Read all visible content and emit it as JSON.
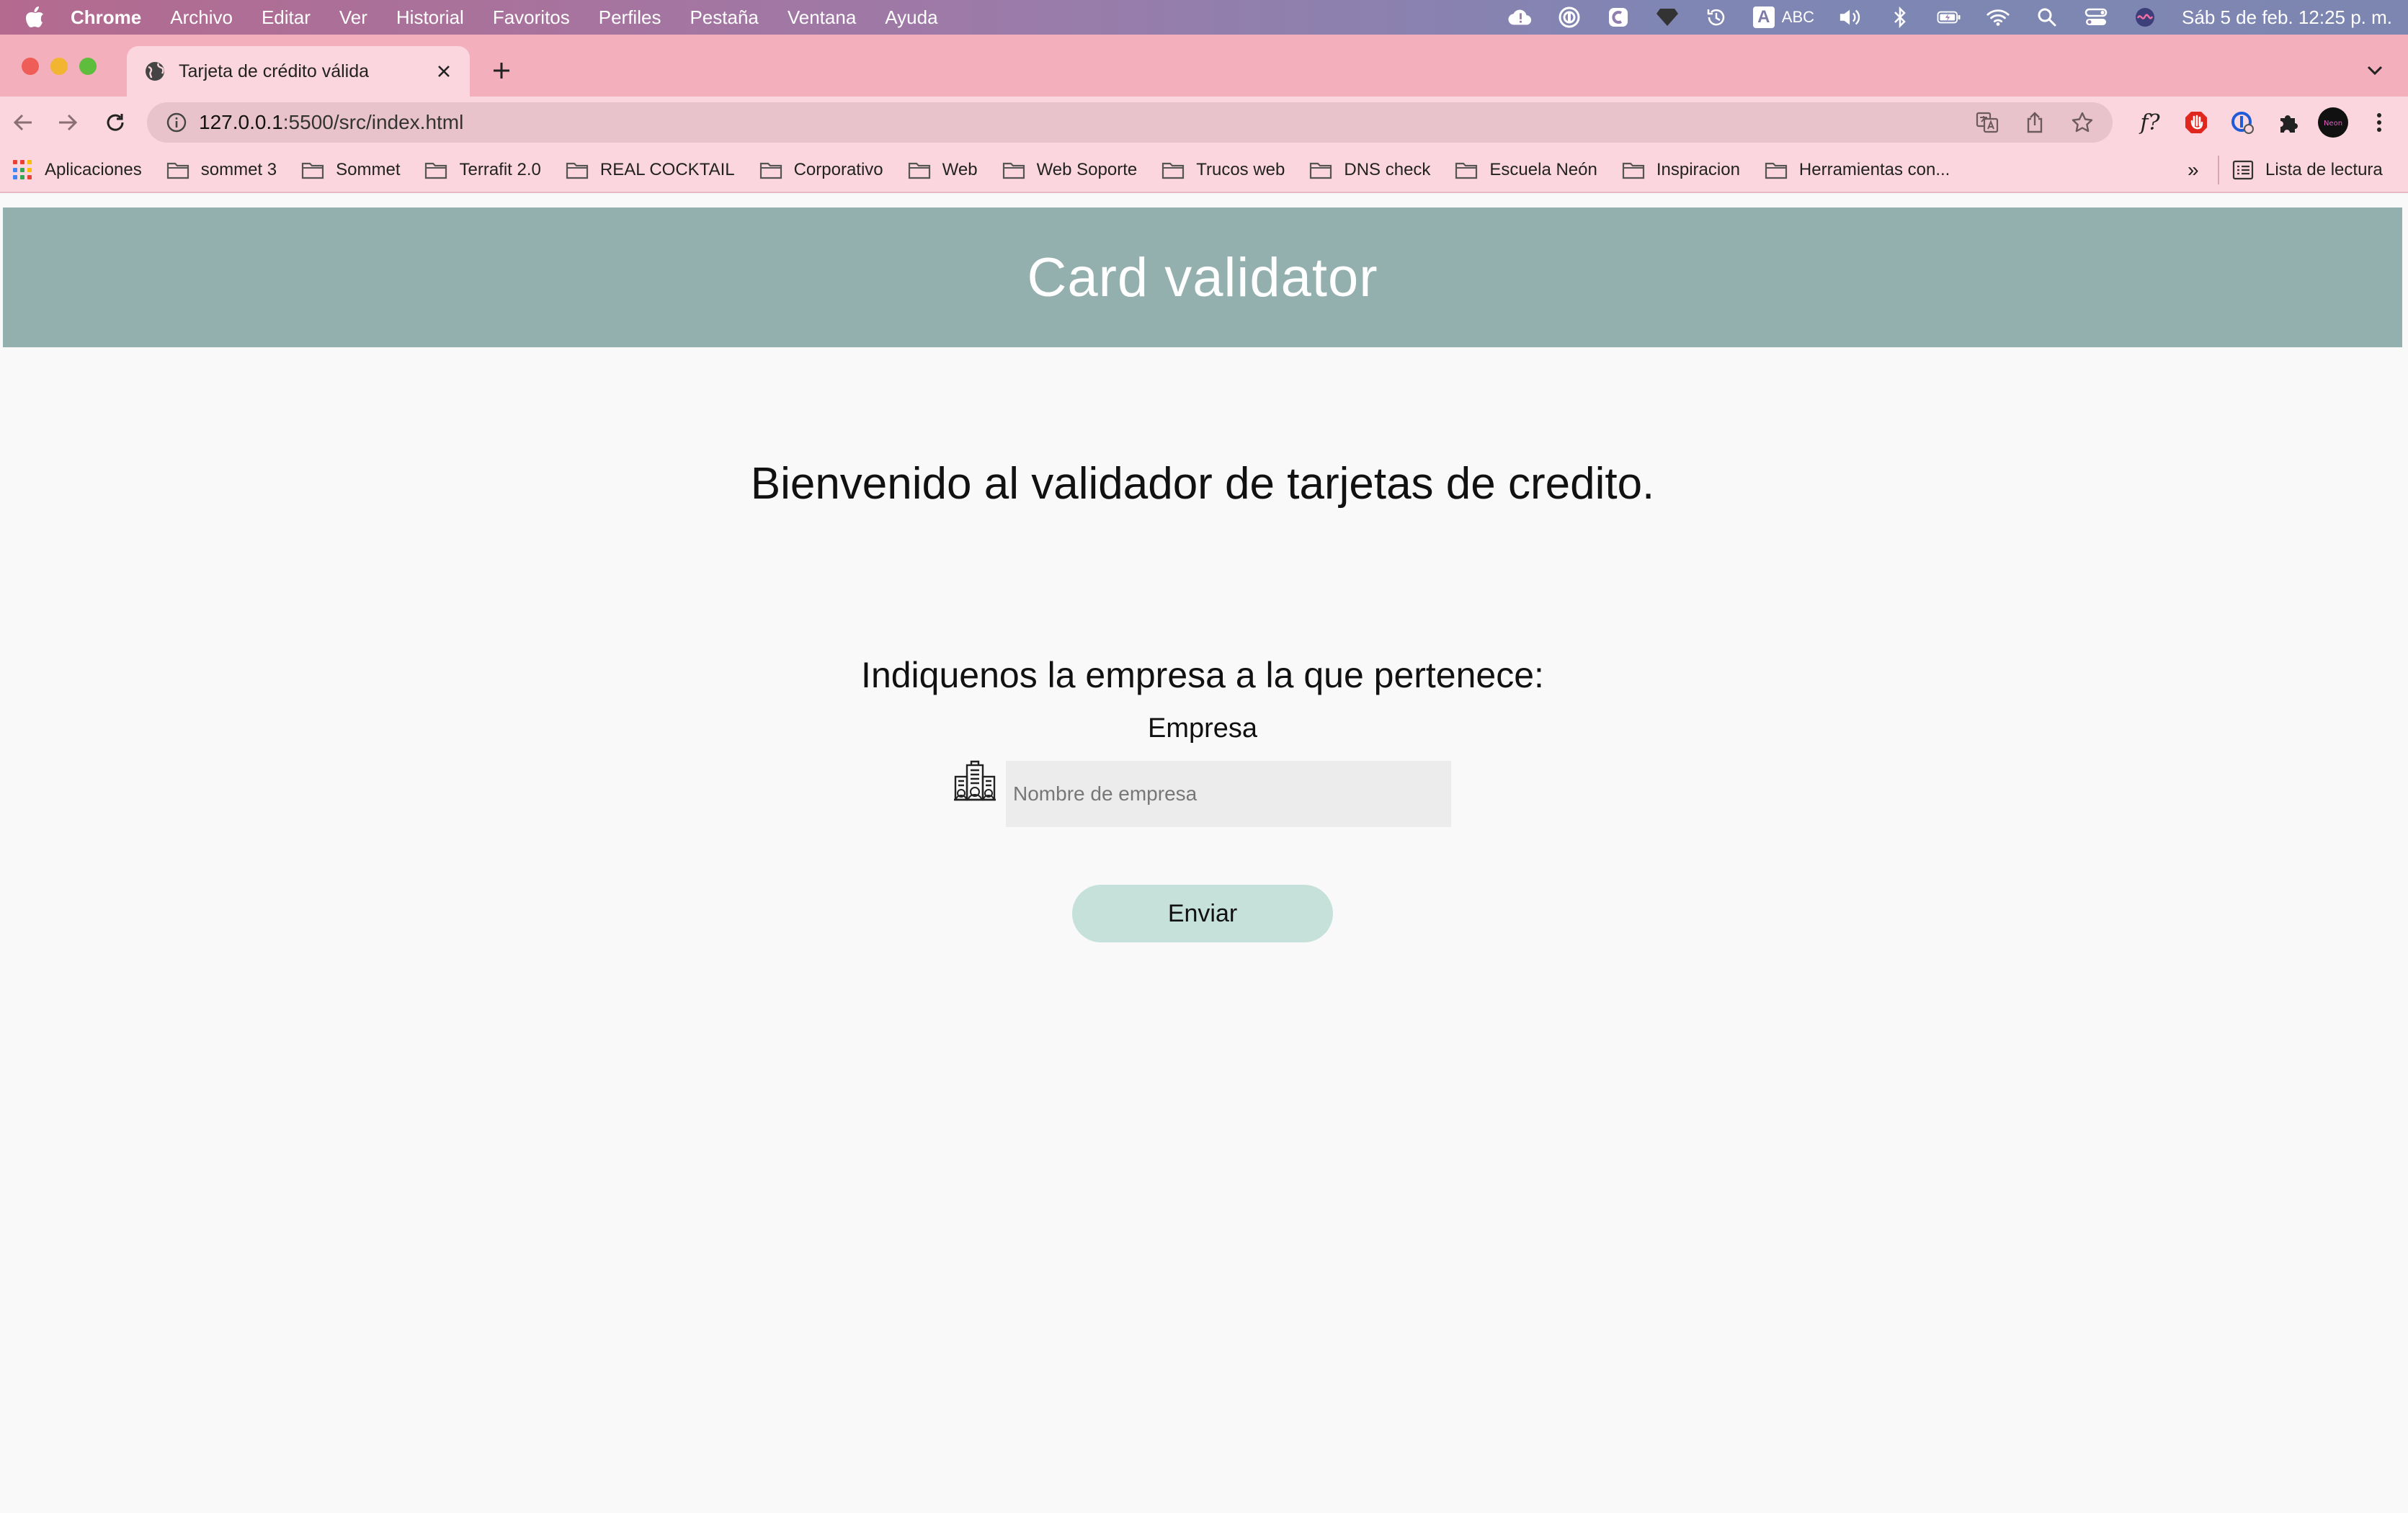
{
  "menubar": {
    "app": "Chrome",
    "items": [
      "Archivo",
      "Editar",
      "Ver",
      "Historial",
      "Favoritos",
      "Perfiles",
      "Pestaña",
      "Ventana",
      "Ayuda"
    ],
    "input_source": "ABC",
    "datetime": "Sáb 5 de feb.  12:25 p. m."
  },
  "browser": {
    "tab_title": "Tarjeta de crédito válida",
    "url_host": "127.0.0.1",
    "url_rest": ":5500/src/index.html",
    "bookmarks": {
      "apps_label": "Aplicaciones",
      "folders": [
        "sommet 3",
        "Sommet",
        "Terrafit 2.0",
        "REAL COCKTAIL",
        "Corporativo",
        "Web",
        "Web Soporte",
        "Trucos web",
        "DNS check",
        "Escuela Neón",
        "Inspiracion",
        "Herramientas con..."
      ],
      "more": "»",
      "reading_list": "Lista de lectura"
    }
  },
  "page": {
    "banner_title": "Card validator",
    "welcome": "Bienvenido al validador de tarjetas de credito.",
    "question": "Indiquenos la empresa a la que pertenece:",
    "field_label": "Empresa",
    "field_placeholder": "Nombre de empresa",
    "field_value": "",
    "submit_label": "Enviar"
  },
  "colors": {
    "banner": "#93b0ae",
    "button": "#c5e1d9",
    "tabstrip": "#f4afbd",
    "toolbar": "#fbd6de"
  }
}
